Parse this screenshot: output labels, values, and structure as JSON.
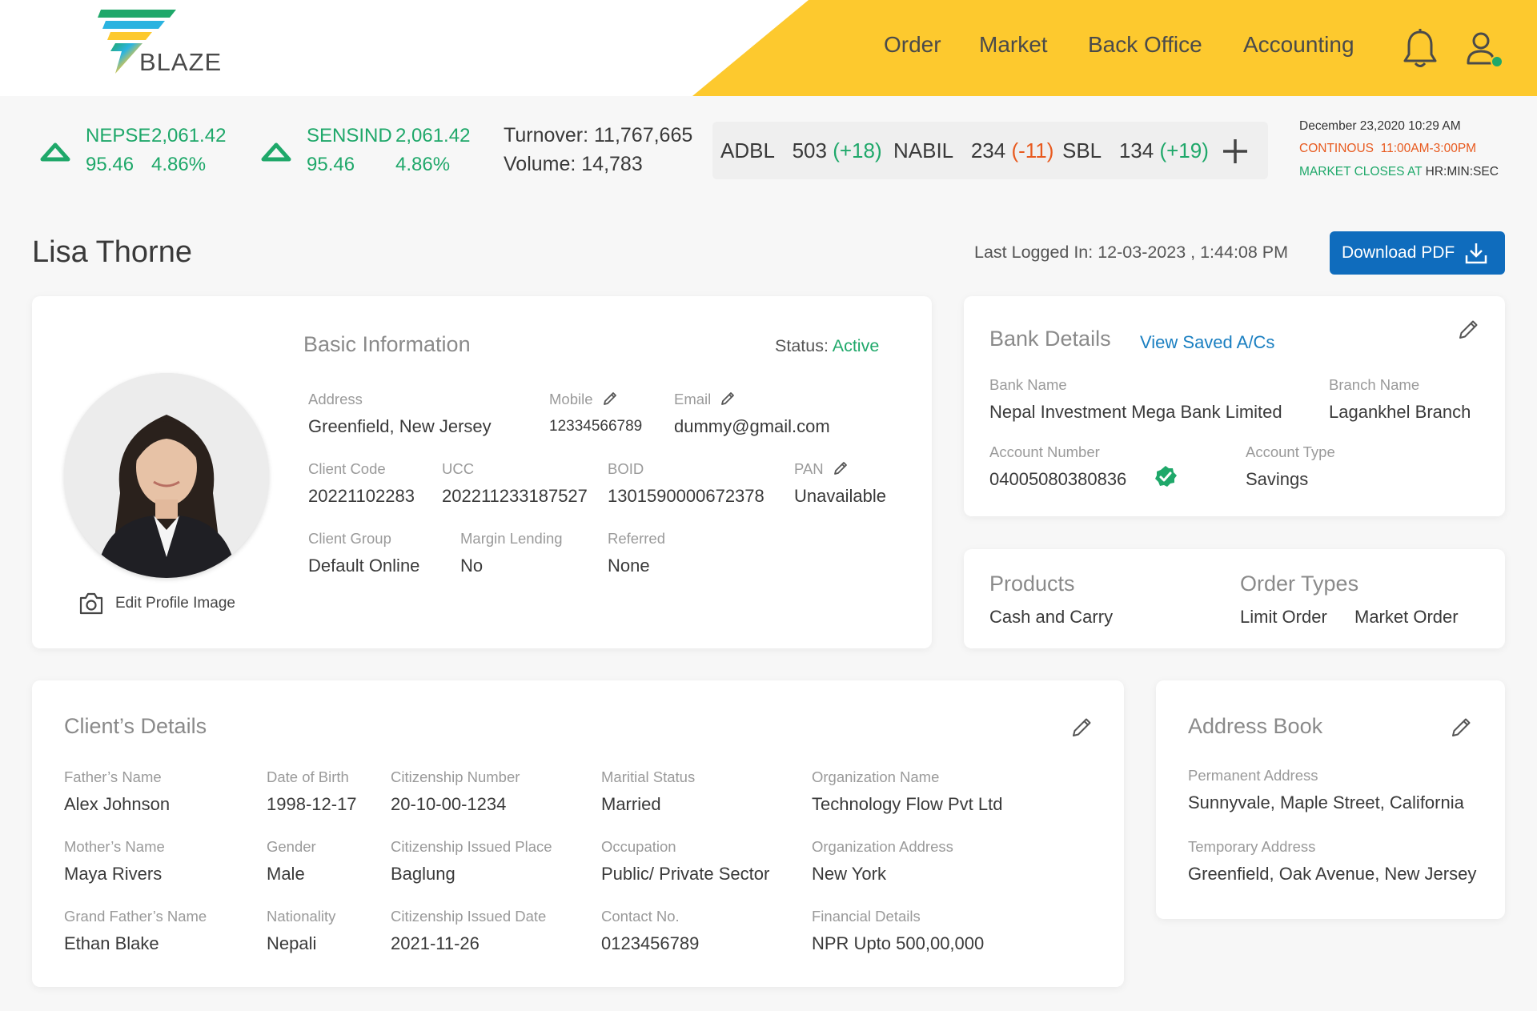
{
  "brand": {
    "name": "BLAZE"
  },
  "nav": {
    "items": [
      "Order",
      "Market",
      "Back Office",
      "Accounting"
    ]
  },
  "ticker": {
    "indices": [
      {
        "name": "NEPSE",
        "value": "2,061.42",
        "change": "95.46",
        "percent": "4.86%"
      },
      {
        "name": "SENSIND",
        "value": "2,061.42",
        "change": "95.46",
        "percent": "4.86%"
      }
    ],
    "turnover": "Turnover: 11,767,665",
    "volume": "Volume: 14,783",
    "watchlist": [
      {
        "symbol": "ADBL",
        "price": "503",
        "change": "(+18)",
        "direction": "up"
      },
      {
        "symbol": "NABIL",
        "price": "234",
        "change": "(-11)",
        "direction": "down"
      },
      {
        "symbol": "SBL",
        "price": "134",
        "change": "(+19)",
        "direction": "up"
      }
    ],
    "datetime": "December 23,2020 10:29 AM",
    "session_label": "CONTINOUS",
    "session_time": "11:00AM-3:00PM",
    "close_label": "MARKET CLOSES AT",
    "close_time": "HR:MIN:SEC"
  },
  "page": {
    "title": "Lisa Thorne",
    "last_logged": "Last Logged In: 12-03-2023 , 1:44:08 PM",
    "download_label": "Download PDF"
  },
  "basic_info": {
    "title": "Basic Information",
    "status_label": "Status:",
    "status_value": "Active",
    "edit_image_label": "Edit Profile Image",
    "fields": {
      "address": {
        "label": "Address",
        "value": "Greenfield, New Jersey"
      },
      "mobile": {
        "label": "Mobile",
        "value": "12334566789"
      },
      "email": {
        "label": "Email",
        "value": "dummy@gmail.com"
      },
      "client_code": {
        "label": "Client Code",
        "value": "20221102283"
      },
      "ucc": {
        "label": "UCC",
        "value": "202211233187527"
      },
      "boid": {
        "label": "BOID",
        "value": "1301590000672378"
      },
      "pan": {
        "label": "PAN",
        "value": "Unavailable"
      },
      "client_group": {
        "label": "Client Group",
        "value": "Default Online"
      },
      "margin_lending": {
        "label": "Margin Lending",
        "value": "No"
      },
      "referred": {
        "label": "Referred",
        "value": "None"
      }
    }
  },
  "bank": {
    "title": "Bank Details",
    "view_saved": "View Saved A/Cs",
    "bank_name": {
      "label": "Bank Name",
      "value": "Nepal Investment Mega Bank Limited"
    },
    "branch_name": {
      "label": "Branch Name",
      "value": "Lagankhel Branch"
    },
    "account_number": {
      "label": "Account Number",
      "value": "04005080380836"
    },
    "account_type": {
      "label": "Account Type",
      "value": "Savings"
    }
  },
  "products": {
    "title": "Products",
    "value": "Cash and Carry",
    "order_types_title": "Order Types",
    "order_types": [
      "Limit Order",
      "Market Order"
    ]
  },
  "client_details": {
    "title": "Client’s Details",
    "fields": [
      {
        "label": "Father’s Name",
        "value": "Alex Johnson"
      },
      {
        "label": "Date of Birth",
        "value": "1998-12-17"
      },
      {
        "label": "Citizenship Number",
        "value": "20-10-00-1234"
      },
      {
        "label": "Maritial Status",
        "value": "Married"
      },
      {
        "label": "Organization Name",
        "value": "Technology Flow Pvt Ltd"
      },
      {
        "label": "Mother’s Name",
        "value": "Maya Rivers"
      },
      {
        "label": "Gender",
        "value": "Male"
      },
      {
        "label": "Citizenship Issued Place",
        "value": "Baglung"
      },
      {
        "label": "Occupation",
        "value": "Public/ Private Sector"
      },
      {
        "label": "Organization Address",
        "value": "New York"
      },
      {
        "label": "Grand Father’s Name",
        "value": "Ethan Blake"
      },
      {
        "label": "Nationality",
        "value": "Nepali"
      },
      {
        "label": "Citizenship Issued Date",
        "value": "2021-11-26"
      },
      {
        "label": "Contact No.",
        "value": "0123456789"
      },
      {
        "label": "Financial Details",
        "value": "NPR Upto 500,00,000"
      }
    ]
  },
  "address_book": {
    "title": "Address Book",
    "permanent": {
      "label": "Permanent Address",
      "value": "Sunnyvale, Maple Street, California"
    },
    "temporary": {
      "label": "Temporary Address",
      "value": "Greenfield, Oak Avenue, New Jersey"
    }
  },
  "colors": {
    "accent_yellow": "#fdc92e",
    "up_green": "#1fa86a",
    "down_red": "#e85a1f",
    "primary_blue": "#0f6cbd",
    "link_blue": "#1a7fc1"
  }
}
